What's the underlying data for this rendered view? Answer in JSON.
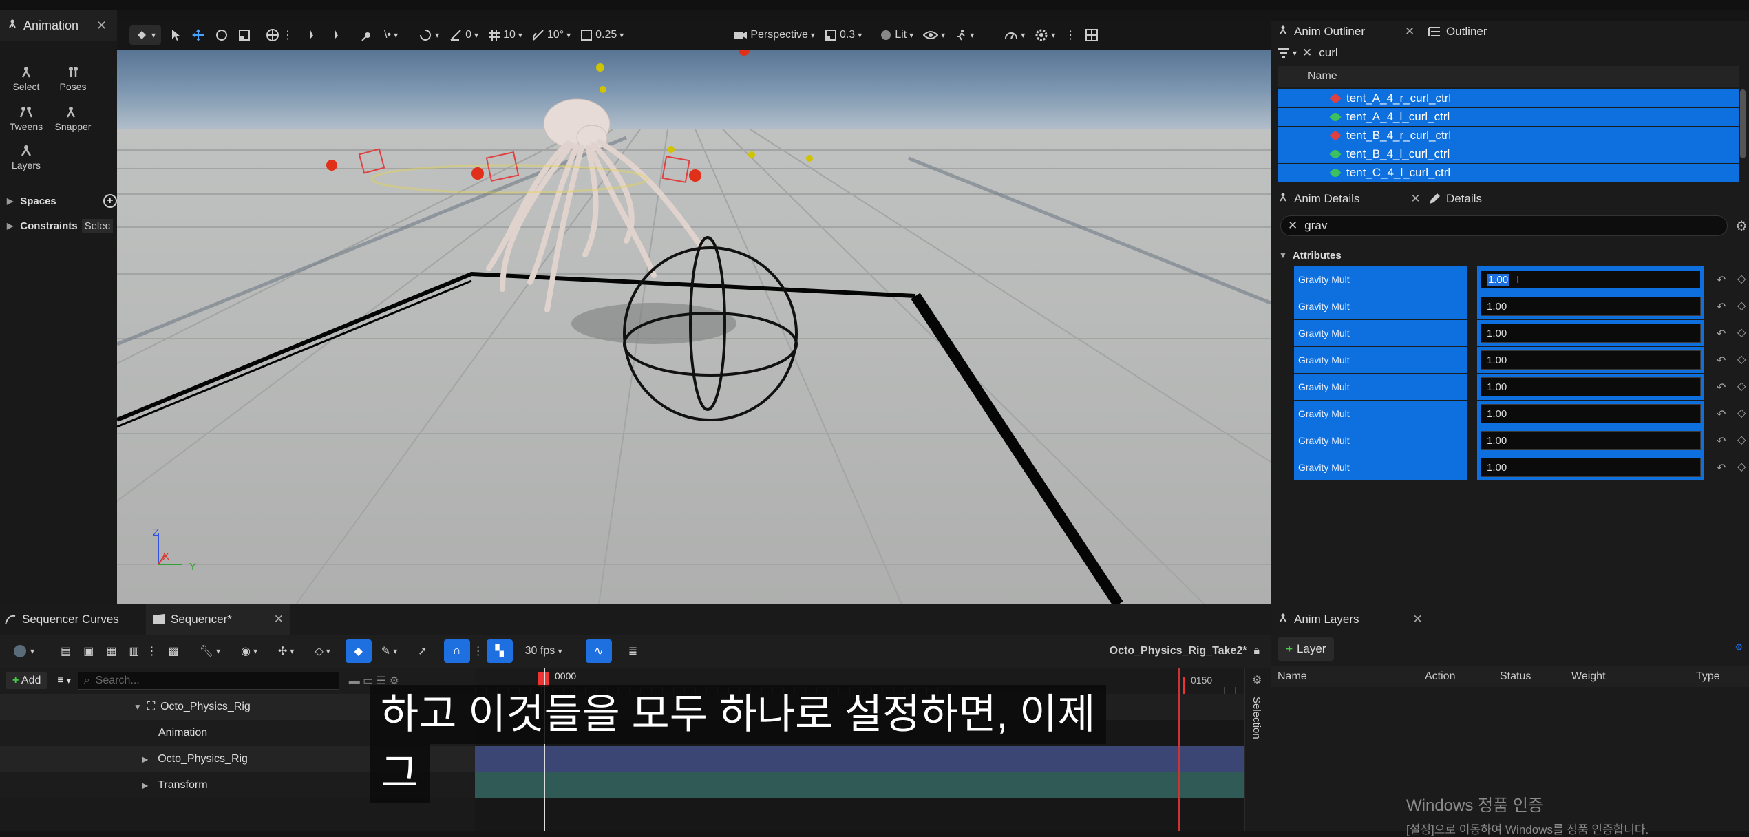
{
  "left": {
    "tab": "Animation",
    "tools": [
      "Select",
      "Poses",
      "Tweens",
      "Snapper",
      "Layers"
    ],
    "sections": [
      "Spaces",
      "Constraints"
    ],
    "select_hint": "Selec"
  },
  "viewport": {
    "snap_angle_a": "0",
    "grid_size": "10",
    "rot_snap": "10°",
    "scale_snap": "0.25",
    "view_mode": "Perspective",
    "camera_speed": "0.3",
    "lighting": "Lit",
    "axis_labels": [
      "Z",
      "X",
      "Y"
    ]
  },
  "outliner": {
    "tab1": "Anim Outliner",
    "tab2": "Outliner",
    "filter": "curl",
    "column": "Name",
    "items": [
      "tent_A_4_r_curl_ctrl",
      "tent_A_4_l_curl_ctrl",
      "tent_B_4_r_curl_ctrl",
      "tent_B_4_l_curl_ctrl",
      "tent_C_4_l_curl_ctrl"
    ],
    "item_colors": [
      "#e04040",
      "#3cc060",
      "#e04040",
      "#3cc060",
      "#3cc060"
    ]
  },
  "details": {
    "tab1": "Anim Details",
    "tab2": "Details",
    "filter": "grav",
    "section": "Attributes",
    "rows": [
      {
        "label": "Gravity Mult",
        "value": "1.00"
      },
      {
        "label": "Gravity Mult",
        "value": "1.00"
      },
      {
        "label": "Gravity Mult",
        "value": "1.00"
      },
      {
        "label": "Gravity Mult",
        "value": "1.00"
      },
      {
        "label": "Gravity Mult",
        "value": "1.00"
      },
      {
        "label": "Gravity Mult",
        "value": "1.00"
      },
      {
        "label": "Gravity Mult",
        "value": "1.00"
      },
      {
        "label": "Gravity Mult",
        "value": "1.00"
      }
    ]
  },
  "sequencer": {
    "tab1": "Sequencer Curves",
    "tab2": "Sequencer*",
    "fps": "30 fps",
    "sequence_name": "Octo_Physics_Rig_Take2*",
    "add_label": "Add",
    "search_placeholder": "Search...",
    "current_frame": "0000",
    "end_frame": "0150",
    "side_label": "Selection",
    "tracks": [
      "Octo_Physics_Rig",
      "Animation",
      "Octo_Physics_Rig",
      "Transform"
    ]
  },
  "anim_layers": {
    "tab": "Anim Layers",
    "button": "Layer",
    "columns": [
      "Name",
      "Action",
      "Status",
      "Weight",
      "Type"
    ]
  },
  "subtitle": {
    "line1": "하고 이것들을 모두 하나로 설정하면, 이제",
    "line2": "그"
  },
  "watermark": {
    "title": "Windows 정품 인증",
    "body": "[설정]으로 이동하여 Windows를 정품 인증합니다."
  },
  "colors": {
    "selection": "#0e70df",
    "accent_orange": "#e05a2a"
  }
}
